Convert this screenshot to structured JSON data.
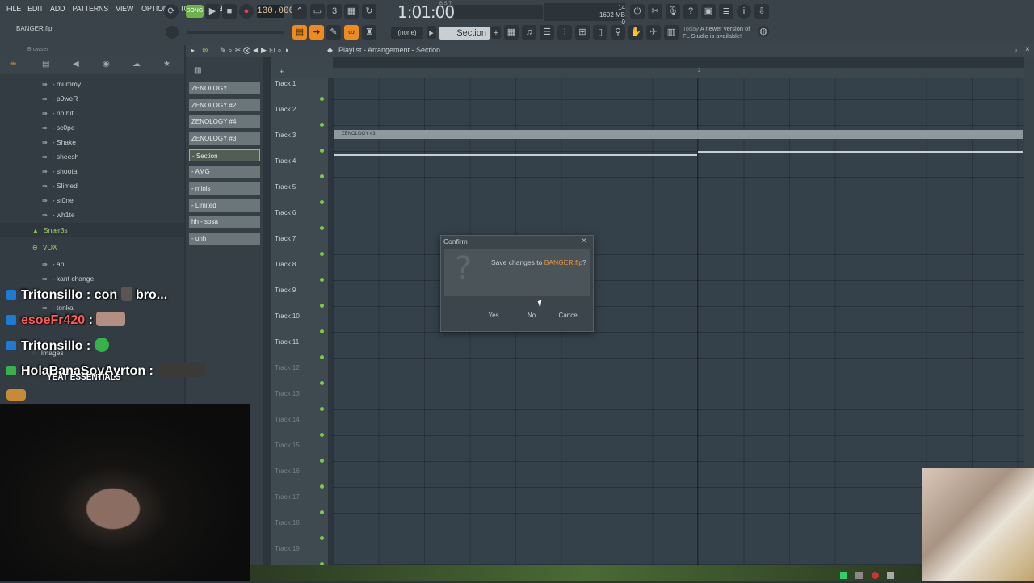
{
  "menu": [
    "FILE",
    "EDIT",
    "ADD",
    "PATTERNS",
    "VIEW",
    "OPTIONS",
    "TOOLS",
    "HELP"
  ],
  "transport": {
    "mode_label": "SONG",
    "tempo": "130.000",
    "time": "1:01:00",
    "time_unit": "B:S:T"
  },
  "cpu": {
    "voices": "14",
    "memory": "1602 MB",
    "cpu": "0"
  },
  "project_file": "BANGER.flp",
  "pattern_selector": {
    "none_label": "(none)",
    "current": "Section"
  },
  "hint": {
    "day": "Today",
    "text_line1": "A newer version of",
    "text_line2": "FL Studio is available!"
  },
  "browser": {
    "label": "Browser",
    "items": [
      {
        "label": "mummy",
        "kind": "file"
      },
      {
        "label": "p0weR",
        "kind": "file"
      },
      {
        "label": "rip hit",
        "kind": "file"
      },
      {
        "label": "sc0pe",
        "kind": "file"
      },
      {
        "label": "Shake",
        "kind": "file"
      },
      {
        "label": "sheesh",
        "kind": "file"
      },
      {
        "label": "shoota",
        "kind": "file"
      },
      {
        "label": "Slimed",
        "kind": "file"
      },
      {
        "label": "st0ne",
        "kind": "file"
      },
      {
        "label": "wh1te",
        "kind": "file"
      },
      {
        "label": "Snær3s",
        "kind": "folder-green"
      },
      {
        "label": "VOX",
        "kind": "folder-open"
      },
      {
        "label": "ah",
        "kind": "file"
      },
      {
        "label": "kant change",
        "kind": "file"
      },
      {
        "label": "tonka",
        "kind": "file"
      },
      {
        "label": "Images",
        "kind": "folder"
      }
    ]
  },
  "patterns": [
    {
      "label": "ZENOLOGY",
      "selected": false
    },
    {
      "label": "ZENOLOGY #2",
      "selected": false
    },
    {
      "label": "ZENOLOGY #4",
      "selected": false
    },
    {
      "label": "ZENOLOGY #3",
      "selected": false
    },
    {
      "label": "- Section",
      "selected": true
    },
    {
      "label": "- AMG",
      "selected": false
    },
    {
      "label": "- minis",
      "selected": false
    },
    {
      "label": "- Limited",
      "selected": false
    },
    {
      "label": "hh - sosa",
      "selected": false
    },
    {
      "label": "- uhh",
      "selected": false
    }
  ],
  "playlist": {
    "title": "Playlist - Arrangement",
    "section": "Section",
    "ruler_bar": "2",
    "clip_label": "ZENOLOGY #3",
    "tracks": [
      "Track 1",
      "Track 2",
      "Track 3",
      "Track 4",
      "Track 5",
      "Track 6",
      "Track 7",
      "Track 8",
      "Track 9",
      "Track 10",
      "Track 11",
      "Track 12",
      "Track 13",
      "Track 14",
      "Track 15",
      "Track 16",
      "Track 17",
      "Track 18",
      "Track 19"
    ],
    "dim_from_index": 11
  },
  "dialog": {
    "title": "Confirm",
    "message_prefix": "Save changes to ",
    "filename": "BANGER.flp",
    "message_suffix": "?",
    "buttons": {
      "yes": "Yes",
      "no": "No",
      "cancel": "Cancel"
    }
  },
  "chat": [
    {
      "user": "Tritonsillo",
      "message": "con",
      "extra": "bro..."
    },
    {
      "user": "esoeFr420",
      "message": ""
    },
    {
      "user": "Tritonsillo",
      "message": ""
    },
    {
      "user": "HolaBanaSoyAyrton",
      "message": ""
    }
  ],
  "overlay_watermark": "YEAT ESSENTIALS",
  "colors": {
    "accent": "#f08a1c",
    "led": "#7ccf3a",
    "selection": "#9dc33b",
    "dialog_filename": "#e8963a"
  }
}
